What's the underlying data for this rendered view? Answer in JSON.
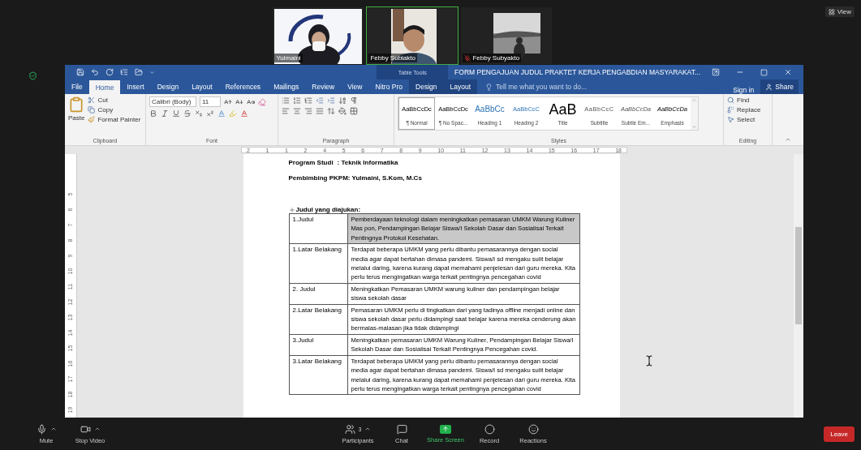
{
  "meeting": {
    "view_label": "View",
    "tiles": [
      {
        "name": "Yulmaini",
        "active": false,
        "muted": false
      },
      {
        "name": "Febby Subiakto",
        "active": true,
        "muted": false
      },
      {
        "name": "Febby Subyakto",
        "active": false,
        "muted": true
      }
    ]
  },
  "word": {
    "title": "FORM PENGAJUAN JUDUL PRAKTET KERJA PENGABDIAN MASYARAKAT...",
    "context_label": "Table Tools",
    "tabs": [
      {
        "label": "File",
        "selected": false,
        "kind": "main"
      },
      {
        "label": "Home",
        "selected": true,
        "kind": "main"
      },
      {
        "label": "Insert",
        "selected": false,
        "kind": "main"
      },
      {
        "label": "Design",
        "selected": false,
        "kind": "main"
      },
      {
        "label": "Layout",
        "selected": false,
        "kind": "main"
      },
      {
        "label": "References",
        "selected": false,
        "kind": "main"
      },
      {
        "label": "Mailings",
        "selected": false,
        "kind": "main"
      },
      {
        "label": "Review",
        "selected": false,
        "kind": "main"
      },
      {
        "label": "View",
        "selected": false,
        "kind": "main"
      },
      {
        "label": "Nitro Pro",
        "selected": false,
        "kind": "main"
      },
      {
        "label": "Design",
        "selected": false,
        "kind": "context"
      },
      {
        "label": "Layout",
        "selected": false,
        "kind": "context"
      }
    ],
    "tell_me": "Tell me what you want to do...",
    "sign_in": "Sign in",
    "share": "Share",
    "clipboard": {
      "paste": "Paste",
      "cut": "Cut",
      "copy": "Copy",
      "format_painter": "Format Painter",
      "label": "Clipboard"
    },
    "font": {
      "name": "Calibri (Body)",
      "size": "11",
      "label": "Font"
    },
    "paragraph": {
      "label": "Paragraph"
    },
    "styles": {
      "label": "Styles",
      "items": [
        {
          "preview": "AaBbCcDc",
          "name": "¶ Normal",
          "kind": "body",
          "selected": true
        },
        {
          "preview": "AaBbCcDc",
          "name": "¶ No Spac...",
          "kind": "body",
          "selected": false
        },
        {
          "preview": "AaBbCc",
          "name": "Heading 1",
          "kind": "heading1",
          "selected": false
        },
        {
          "preview": "AaBbCcC",
          "name": "Heading 2",
          "kind": "heading2",
          "selected": false
        },
        {
          "preview": "AaB",
          "name": "Title",
          "kind": "title",
          "selected": false
        },
        {
          "preview": "AaBbCcC",
          "name": "Subtitle",
          "kind": "subtitle",
          "selected": false
        },
        {
          "preview": "AaBbCcDa",
          "name": "Subtle Em...",
          "kind": "subtle",
          "selected": false
        },
        {
          "preview": "AaBbCcDa",
          "name": "Emphasis",
          "kind": "emphasis",
          "selected": false
        }
      ]
    },
    "editing": {
      "find": "Find",
      "replace": "Replace",
      "select": "Select",
      "label": "Editing"
    },
    "ruler": [
      "2",
      "1",
      "1",
      "2",
      "4",
      "5",
      "6",
      "7",
      "8",
      "9",
      "10",
      "11",
      "12",
      "13",
      "14",
      "15",
      "16",
      "17",
      "18"
    ],
    "vruler": [
      "5",
      "6",
      "7",
      "8",
      "9",
      "10",
      "11",
      "12",
      "13",
      "14",
      "15",
      "16",
      "17",
      "18",
      "19"
    ],
    "document": {
      "fields": [
        {
          "label": "Program Studi",
          "value": ": Teknik Informatika"
        },
        {
          "label": "Pembimbing PKPM",
          "value": ": Yulmaini, S.Kom, M.Cs"
        }
      ],
      "heading": "Judul yang diajukan:",
      "rows": [
        {
          "label": "1.Judul",
          "text": "Pemberdayaan teknologi dalam meningkatkan pemasaran UMKM Warung Kuliner Mas pon, Pendampingan Belajar Siswa/I Sekolah Dasar dan Sosialisai Terkait Pentingnya Protokol Kesehatan.",
          "selected": true
        },
        {
          "label": "1.Latar Belakang",
          "text": "Terdapat beberapa UMKM yang perlu dibantu pemasarannya dengan social media agar dapat bertahan dimasa pandemi. Siswa/I sd mengaku sulit belajar melalui daring, karena kurang dapat memahami penjelesan dari guru mereka. Kita perlu terus mengingatkan warga terkait pentingnya pencegahan covid",
          "selected": false
        },
        {
          "label": "2. Judul",
          "text": "Meningkatkan Pemasaran UMKM warung kuliner dan pendampingan belajar siswa sekolah dasar",
          "selected": false
        },
        {
          "label": "2.Latar Belakang",
          "text": "Pemasaran UMKM perlu di tingkatkan dari yang tadinya offline menjadi online dan siswa sekolah dasar perlu didampingi saat belajar karena mereka cenderung akan bermalas-malasan jika tidak didampingi",
          "selected": false
        },
        {
          "label": "3.Judul",
          "text": "Meningkatkan pemasaran UMKM Warung Kuliner, Pendampingan Belajar Siswa/I Sekolah Dasar dan Sosialisai Terkait Pentingnya Pencegahan covid.",
          "selected": false
        },
        {
          "label": "3.Latar Belakang",
          "text": "Terdapat beberapa UMKM yang perlu dibantu pemasarannya dengan social media agar dapat bertahan dimasa pandemi. Siswa/I sd mengaku sulit belajar melalui daring, karena kurang dapat memahami penjelesan dari guru mereka. Kita perlu terus mengingatkan warga terkait pentingnya pencegahan covid",
          "selected": false
        }
      ]
    }
  },
  "toolbar": {
    "items": [
      {
        "label": "Mute",
        "kind": "mic",
        "caret": true
      },
      {
        "label": "Stop Video",
        "kind": "video",
        "caret": true
      },
      {
        "label": "Participants",
        "kind": "participants",
        "count": "3",
        "caret": true
      },
      {
        "label": "Chat",
        "kind": "chat",
        "caret": false
      },
      {
        "label": "Share Screen",
        "kind": "share",
        "caret": false
      },
      {
        "label": "Record",
        "kind": "record",
        "caret": false
      },
      {
        "label": "Reactions",
        "kind": "reactions",
        "caret": false
      }
    ],
    "leave": "Leave"
  }
}
